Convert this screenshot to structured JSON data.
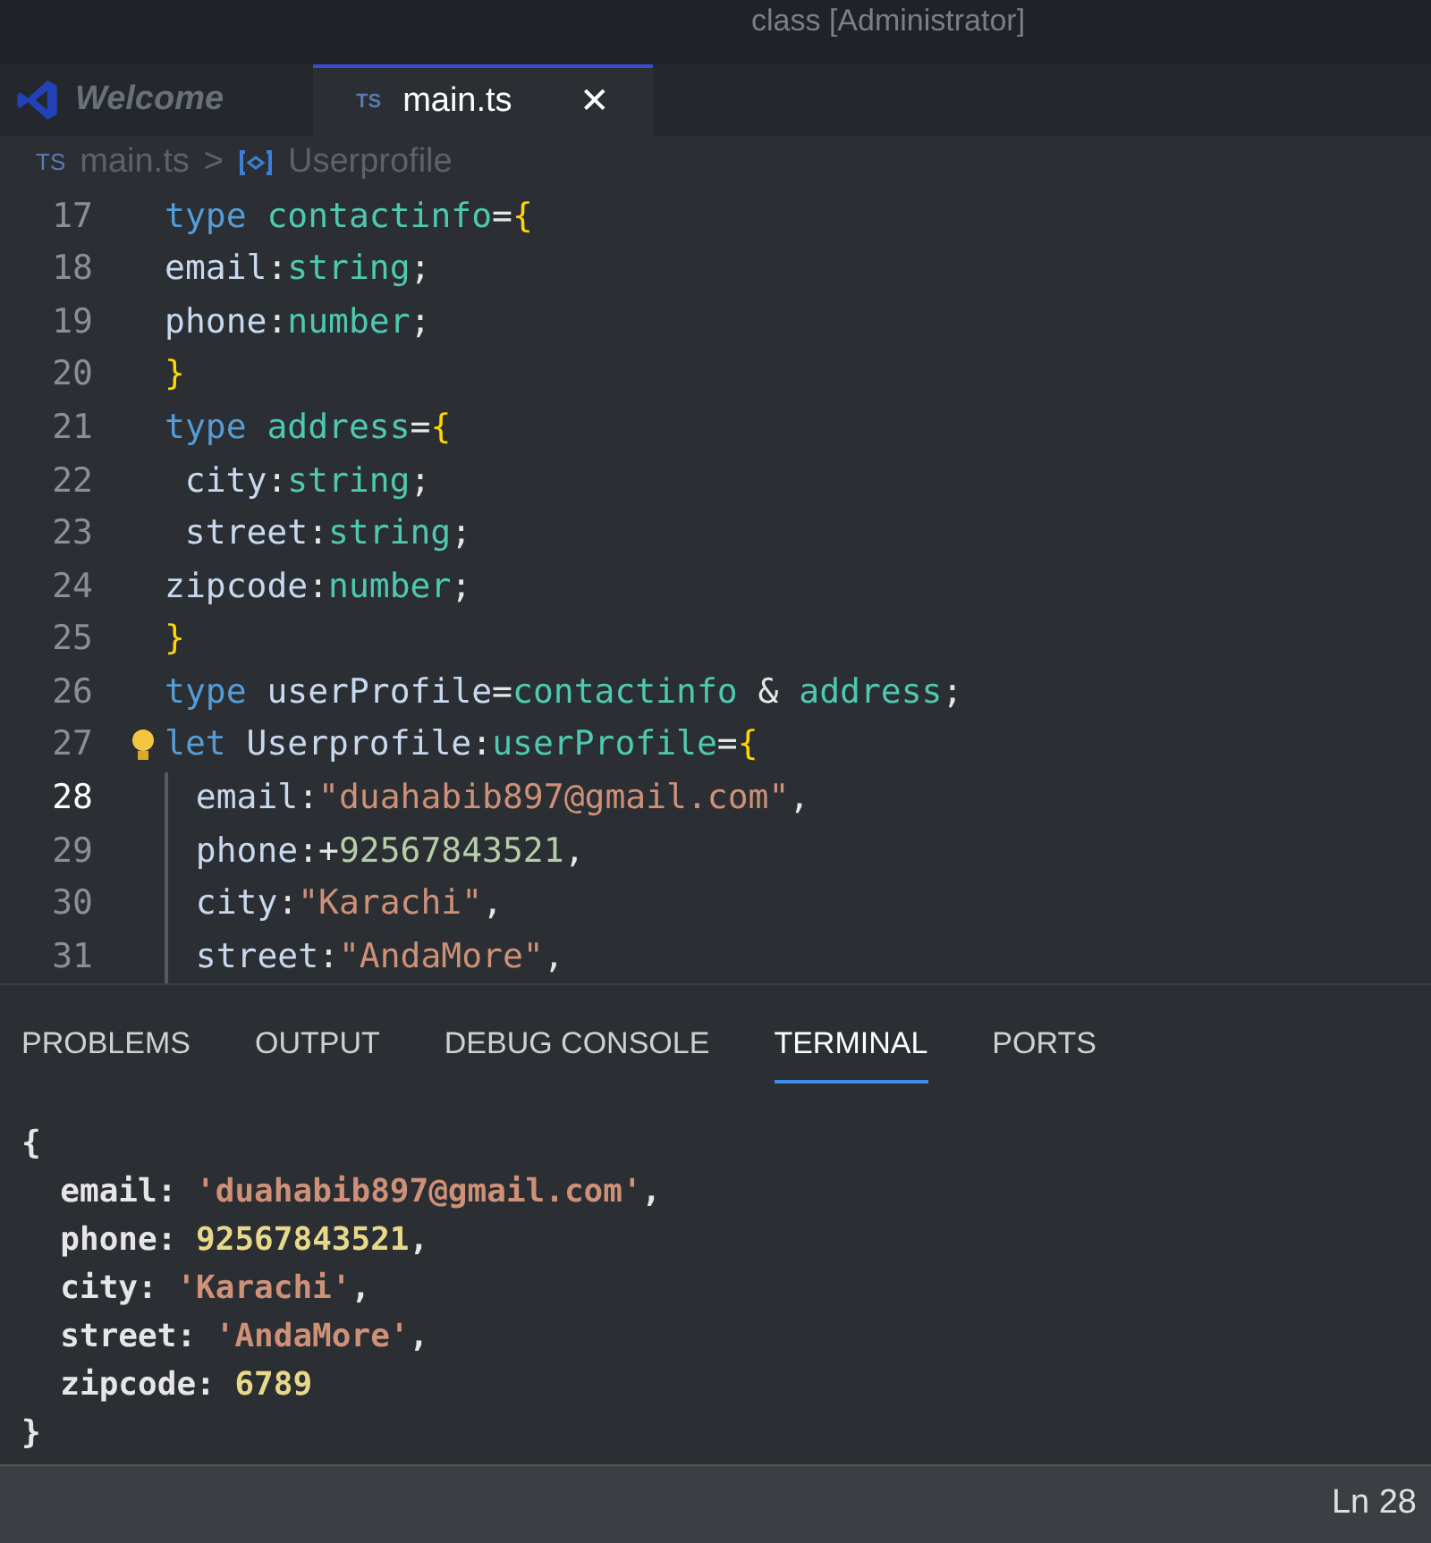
{
  "title_fragment": "class [Administrator]",
  "tabs": [
    {
      "label": "Welcome",
      "kind": "welcome",
      "selected": false
    },
    {
      "label": "main.ts",
      "kind": "ts",
      "badge": "TS",
      "selected": true,
      "close": "✕"
    }
  ],
  "breadcrumb": {
    "file_badge": "TS",
    "file": "main.ts",
    "separator": ">",
    "symbol": "Userprofile"
  },
  "editor": {
    "lines": [
      {
        "number": "17",
        "current": false,
        "indented": false,
        "tokens": [
          {
            "text": "type ",
            "kind": "keyword"
          },
          {
            "text": "contactinfo",
            "kind": "typename"
          },
          {
            "text": "=",
            "kind": "punct"
          },
          {
            "text": "{",
            "kind": "brace"
          }
        ]
      },
      {
        "number": "18",
        "current": false,
        "indented": false,
        "tokens": [
          {
            "text": "email",
            "kind": "prop"
          },
          {
            "text": ":",
            "kind": "punct"
          },
          {
            "text": "string",
            "kind": "typename"
          },
          {
            "text": ";",
            "kind": "punct"
          }
        ]
      },
      {
        "number": "19",
        "current": false,
        "indented": false,
        "tokens": [
          {
            "text": "phone",
            "kind": "prop"
          },
          {
            "text": ":",
            "kind": "punct"
          },
          {
            "text": "number",
            "kind": "typename"
          },
          {
            "text": ";",
            "kind": "punct"
          }
        ]
      },
      {
        "number": "20",
        "current": false,
        "indented": false,
        "tokens": [
          {
            "text": "}",
            "kind": "brace"
          }
        ]
      },
      {
        "number": "21",
        "current": false,
        "indented": false,
        "tokens": [
          {
            "text": "type ",
            "kind": "keyword"
          },
          {
            "text": "address",
            "kind": "typename"
          },
          {
            "text": "=",
            "kind": "punct"
          },
          {
            "text": "{",
            "kind": "brace"
          }
        ]
      },
      {
        "number": "22",
        "current": false,
        "indented": true,
        "tokens": [
          {
            "text": "city",
            "kind": "prop"
          },
          {
            "text": ":",
            "kind": "punct"
          },
          {
            "text": "string",
            "kind": "typename"
          },
          {
            "text": ";",
            "kind": "punct"
          }
        ]
      },
      {
        "number": "23",
        "current": false,
        "indented": true,
        "tokens": [
          {
            "text": "street",
            "kind": "prop"
          },
          {
            "text": ":",
            "kind": "punct"
          },
          {
            "text": "string",
            "kind": "typename"
          },
          {
            "text": ";",
            "kind": "punct"
          }
        ]
      },
      {
        "number": "24",
        "current": false,
        "indented": false,
        "tokens": [
          {
            "text": "zipcode",
            "kind": "prop"
          },
          {
            "text": ":",
            "kind": "punct"
          },
          {
            "text": "number",
            "kind": "typename"
          },
          {
            "text": ";",
            "kind": "punct"
          }
        ]
      },
      {
        "number": "25",
        "current": false,
        "indented": false,
        "tokens": [
          {
            "text": "}",
            "kind": "brace"
          }
        ]
      },
      {
        "number": "26",
        "current": false,
        "indented": false,
        "tokens": [
          {
            "text": "type ",
            "kind": "keyword"
          },
          {
            "text": "userProfile",
            "kind": "var"
          },
          {
            "text": "=",
            "kind": "punct"
          },
          {
            "text": "contactinfo",
            "kind": "typename"
          },
          {
            "text": " & ",
            "kind": "punct"
          },
          {
            "text": "address",
            "kind": "typename"
          },
          {
            "text": ";",
            "kind": "punct"
          }
        ]
      },
      {
        "number": "27",
        "current": false,
        "indented": false,
        "bulb": true,
        "tokens": [
          {
            "text": "let ",
            "kind": "keyword"
          },
          {
            "text": "Userprofile",
            "kind": "var"
          },
          {
            "text": ":",
            "kind": "punct"
          },
          {
            "text": "userProfile",
            "kind": "typename"
          },
          {
            "text": "=",
            "kind": "punct"
          },
          {
            "text": "{",
            "kind": "brace"
          }
        ]
      },
      {
        "number": "28",
        "current": true,
        "indented": true,
        "guide": true,
        "tokens": [
          {
            "text": "email",
            "kind": "prop"
          },
          {
            "text": ":",
            "kind": "punct"
          },
          {
            "text": "\"duahabib897@gmail.com\"",
            "kind": "string"
          },
          {
            "text": ",",
            "kind": "punct"
          }
        ]
      },
      {
        "number": "29",
        "current": false,
        "indented": true,
        "guide": true,
        "tokens": [
          {
            "text": "phone",
            "kind": "prop"
          },
          {
            "text": ":+",
            "kind": "punct"
          },
          {
            "text": "92567843521",
            "kind": "num"
          },
          {
            "text": ",",
            "kind": "punct"
          }
        ]
      },
      {
        "number": "30",
        "current": false,
        "indented": true,
        "guide": true,
        "tokens": [
          {
            "text": "city",
            "kind": "prop"
          },
          {
            "text": ":",
            "kind": "punct"
          },
          {
            "text": "\"Karachi\"",
            "kind": "string"
          },
          {
            "text": ",",
            "kind": "punct"
          }
        ]
      },
      {
        "number": "31",
        "current": false,
        "indented": true,
        "guide": true,
        "tokens": [
          {
            "text": "street",
            "kind": "prop"
          },
          {
            "text": ":",
            "kind": "punct"
          },
          {
            "text": "\"AndaMore\"",
            "kind": "string"
          },
          {
            "text": ",",
            "kind": "punct"
          }
        ]
      }
    ]
  },
  "panel_tabs": [
    {
      "label": "PROBLEMS",
      "selected": false
    },
    {
      "label": "OUTPUT",
      "selected": false
    },
    {
      "label": "DEBUG CONSOLE",
      "selected": false
    },
    {
      "label": "TERMINAL",
      "selected": true
    },
    {
      "label": "PORTS",
      "selected": false
    }
  ],
  "terminal": {
    "lines": [
      {
        "tokens": [
          {
            "text": "{",
            "kind": "punct"
          }
        ]
      },
      {
        "tokens": [
          {
            "text": "  email: ",
            "kind": "punct"
          },
          {
            "text": "'duahabib897@gmail.com'",
            "kind": "string"
          },
          {
            "text": ",",
            "kind": "punct"
          }
        ]
      },
      {
        "tokens": [
          {
            "text": "  phone: ",
            "kind": "punct"
          },
          {
            "text": "92567843521",
            "kind": "numlit"
          },
          {
            "text": ",",
            "kind": "punct"
          }
        ]
      },
      {
        "tokens": [
          {
            "text": "  city: ",
            "kind": "punct"
          },
          {
            "text": "'Karachi'",
            "kind": "string"
          },
          {
            "text": ",",
            "kind": "punct"
          }
        ]
      },
      {
        "tokens": [
          {
            "text": "  street: ",
            "kind": "punct"
          },
          {
            "text": "'AndaMore'",
            "kind": "string"
          },
          {
            "text": ",",
            "kind": "punct"
          }
        ]
      },
      {
        "tokens": [
          {
            "text": "  zipcode: ",
            "kind": "punct"
          },
          {
            "text": "6789",
            "kind": "numlit"
          }
        ]
      },
      {
        "tokens": [
          {
            "text": "}",
            "kind": "punct"
          }
        ]
      }
    ]
  },
  "status_bar": {
    "position": "Ln 28"
  }
}
